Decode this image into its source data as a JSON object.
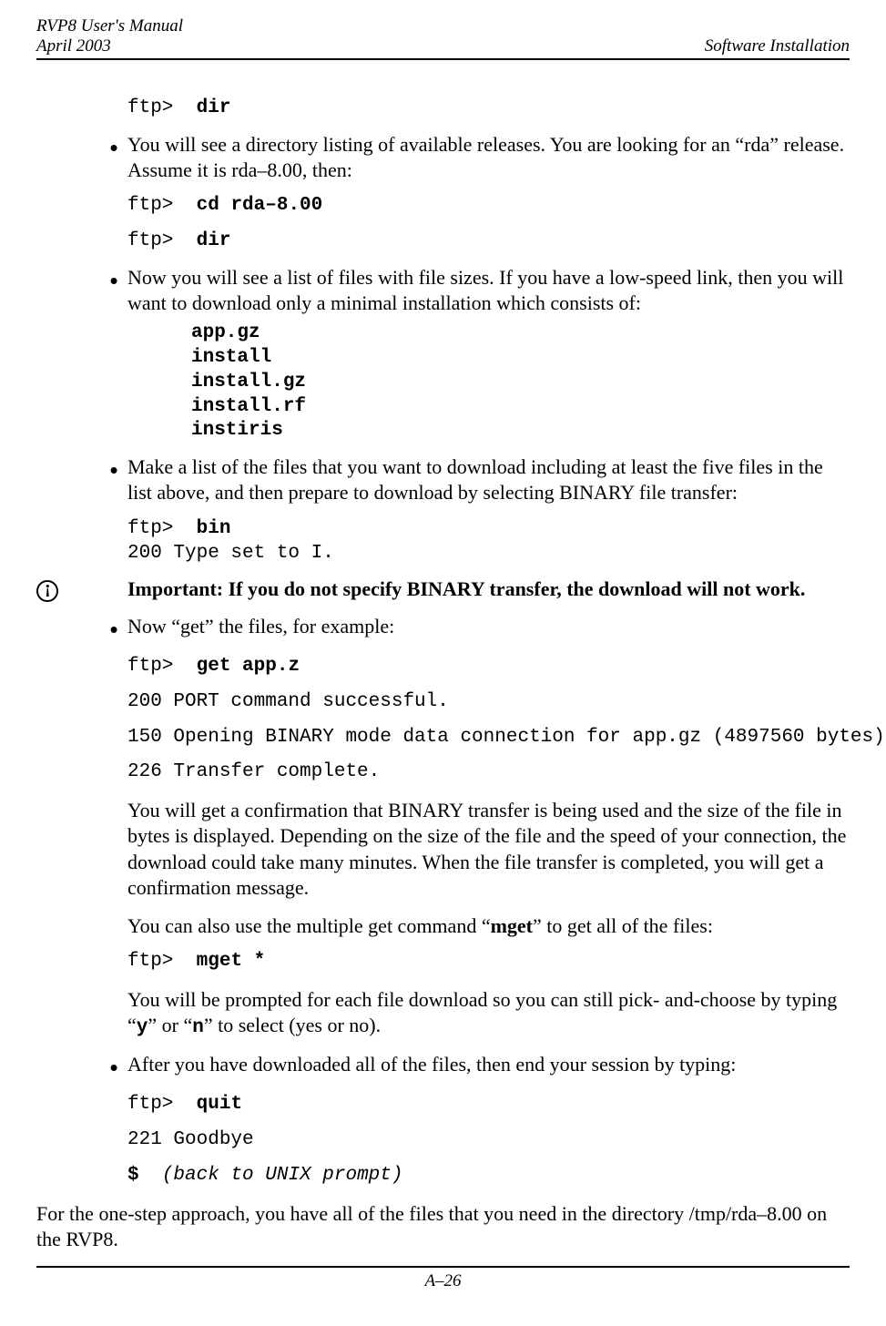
{
  "header": {
    "title_line1": "RVP8 User's Manual",
    "title_line2": "April 2003",
    "right": "Software Installation"
  },
  "ftp_prompt": "ftp>",
  "cmd_dir": "dir",
  "bullet1": "You will see a directory listing of available releases. You are looking for an “rda” release. Assume it is rda–8.00, then:",
  "cmd_cd": "cd rda–8.00",
  "bullet2": "Now you will see a list of files with file sizes. If you have a low-speed link, then you will want to download only a minimal installation which consists of:",
  "files": {
    "f1": "app.gz",
    "f2": "install",
    "f3": "install.gz",
    "f4": "install.rf",
    "f5": "instiris"
  },
  "bullet3": "Make a list of the files that you want to download including at least the five files in the list above, and then prepare to download by selecting BINARY file transfer:",
  "cmd_bin": "bin",
  "resp_bin": "200 Type set to I.",
  "important": "Important: If you do not specify BINARY transfer, the download will not work.",
  "bullet4": "Now “get” the files, for example:",
  "cmd_get": "get app.z",
  "resp_port": "200 PORT command successful.",
  "resp_open": "150 Opening BINARY mode data connection for app.gz (4897560 bytes)",
  "resp_transfer": "226 Transfer complete.",
  "para_confirm": "You will get a confirmation that BINARY transfer is being used and the size of the file in bytes is displayed. Depending on the size of the file and the speed of your connection, the download could take many minutes. When the file transfer is completed, you will get a confirmation message.",
  "para_mget_pre": "You can also use the multiple get command “",
  "mget": "mget",
  "para_mget_post": "” to get all of the files:",
  "cmd_mget": "mget *",
  "para_prompt_pre": "You will be prompted for each file download so you can still pick- and-choose by typing “",
  "y": "y",
  "para_prompt_mid": "” or “",
  "n": "n",
  "para_prompt_post": "” to select (yes or no).",
  "bullet5": "After you have downloaded all of the files, then end your session by typing:",
  "cmd_quit": "quit",
  "resp_goodbye": "221 Goodbye",
  "dollar": "$",
  "back_prompt": "(back to UNIX prompt)",
  "para_onestep": "For the one-step approach, you have all of the files that you need in the directory /tmp/rda–8.00 on the RVP8.",
  "page_number": "A–26",
  "alert_glyph": "!"
}
